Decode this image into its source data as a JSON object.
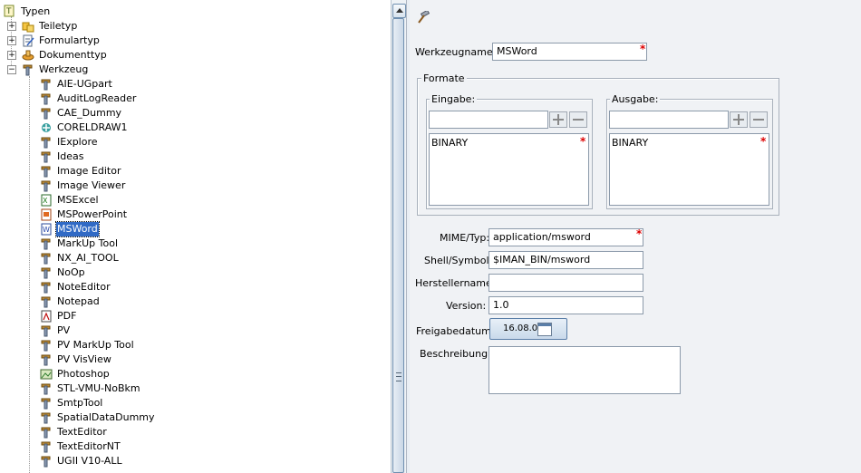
{
  "tree": {
    "root": "Typen",
    "groups": [
      {
        "label": "Teiletyp",
        "expanded": false
      },
      {
        "label": "Formulartyp",
        "expanded": false
      },
      {
        "label": "Dokumenttyp",
        "expanded": false
      },
      {
        "label": "Werkzeug",
        "expanded": true
      }
    ],
    "tools": [
      {
        "label": "AIE-UGpart",
        "icon": "tool-icon"
      },
      {
        "label": "AuditLogReader",
        "icon": "tool-icon"
      },
      {
        "label": "CAE_Dummy",
        "icon": "tool-icon"
      },
      {
        "label": "CORELDRAW1",
        "icon": "coreldraw-icon"
      },
      {
        "label": "IExplore",
        "icon": "tool-icon"
      },
      {
        "label": "Ideas",
        "icon": "tool-icon"
      },
      {
        "label": "Image Editor",
        "icon": "tool-icon"
      },
      {
        "label": "Image Viewer",
        "icon": "tool-icon"
      },
      {
        "label": "MSExcel",
        "icon": "excel-icon"
      },
      {
        "label": "MSPowerPoint",
        "icon": "powerpoint-icon"
      },
      {
        "label": "MSWord",
        "icon": "word-icon",
        "selected": true
      },
      {
        "label": "MarkUp Tool",
        "icon": "tool-icon"
      },
      {
        "label": "NX_AI_TOOL",
        "icon": "tool-icon"
      },
      {
        "label": "NoOp",
        "icon": "tool-icon"
      },
      {
        "label": "NoteEditor",
        "icon": "tool-icon"
      },
      {
        "label": "Notepad",
        "icon": "tool-icon"
      },
      {
        "label": "PDF",
        "icon": "pdf-icon"
      },
      {
        "label": "PV",
        "icon": "tool-icon"
      },
      {
        "label": "PV MarkUp Tool",
        "icon": "tool-icon"
      },
      {
        "label": "PV VisView",
        "icon": "tool-icon"
      },
      {
        "label": "Photoshop",
        "icon": "photoshop-icon"
      },
      {
        "label": "STL-VMU-NoBkm",
        "icon": "tool-icon"
      },
      {
        "label": "SmtpTool",
        "icon": "tool-icon"
      },
      {
        "label": "SpatialDataDummy",
        "icon": "tool-icon"
      },
      {
        "label": "TextEditor",
        "icon": "tool-icon"
      },
      {
        "label": "TextEditorNT",
        "icon": "tool-icon"
      },
      {
        "label": "UGII V10-ALL",
        "icon": "tool-icon"
      }
    ]
  },
  "form": {
    "toolname_label": "Werkzeugname:",
    "toolname_value": "MSWord",
    "formats_label": "Formate",
    "input_label": "Eingabe:",
    "input_list": [
      "BINARY"
    ],
    "output_label": "Ausgabe:",
    "output_list": [
      "BINARY"
    ],
    "mime_label": "MIME/Typ:",
    "mime_value": "application/msword",
    "shell_label": "Shell/Symbol:",
    "shell_value": "$IMAN_BIN/msword",
    "vendor_label": "Herstellername:",
    "vendor_value": "",
    "version_label": "Version:",
    "version_value": "1.0",
    "release_label": "Freigabedatum:",
    "release_value": "16.08.05",
    "description_label": "Beschreibung:",
    "description_value": ""
  }
}
